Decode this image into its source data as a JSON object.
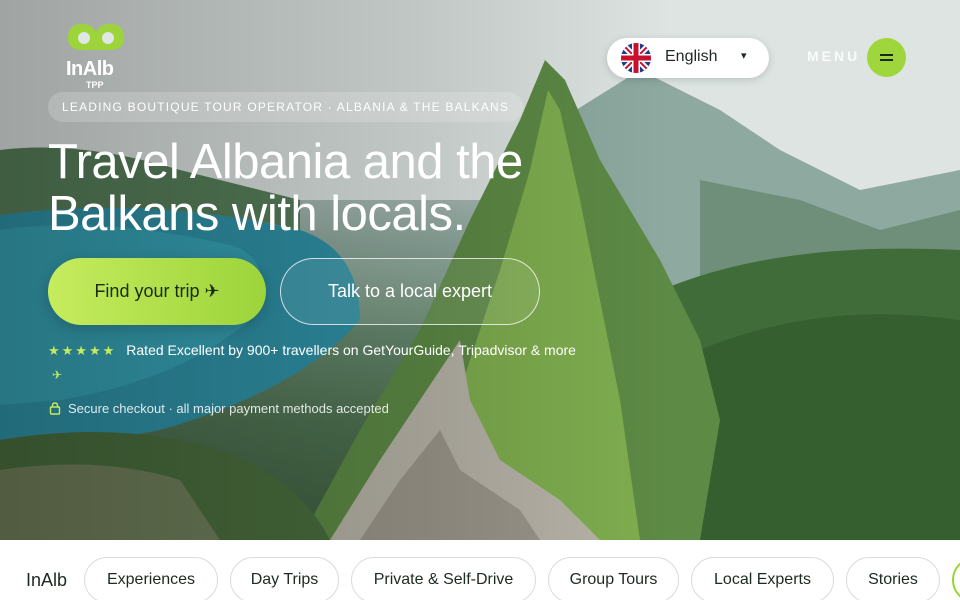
{
  "header": {
    "logo_text": "InAlb",
    "logo_sub": "TPP",
    "tagline": "LEADING BOUTIQUE TOUR OPERATOR · ALBANIA & THE BALKANS",
    "language": {
      "label": "English",
      "caret": "▾",
      "flag_icon": "uk-flag-icon"
    },
    "menu_label": "MENU",
    "menu_icon": "hamburger-icon"
  },
  "hero": {
    "title": "Travel Albania and the Balkans with locals.",
    "primary_button": "Find your trip ✈",
    "secondary_button": "Talk to a local expert",
    "stars": "★★★★★",
    "rating_text": "Rated Excellent by 900+ travellers on GetYourGuide, Tripadvisor & more",
    "rating_arrow": "✈",
    "secure_text": "Secure checkout · all major payment methods accepted"
  },
  "nav": {
    "brand": "InAlb",
    "items": [
      {
        "label": "Experiences"
      },
      {
        "label": "Day Trips"
      },
      {
        "label": "Private & Self-Drive"
      },
      {
        "label": "Group Tours"
      },
      {
        "label": "Local Experts"
      },
      {
        "label": "Stories"
      }
    ]
  },
  "colors": {
    "accent": "#9cd43a",
    "accent_light": "#c6ec5e",
    "text_dark": "#1d2a22"
  }
}
